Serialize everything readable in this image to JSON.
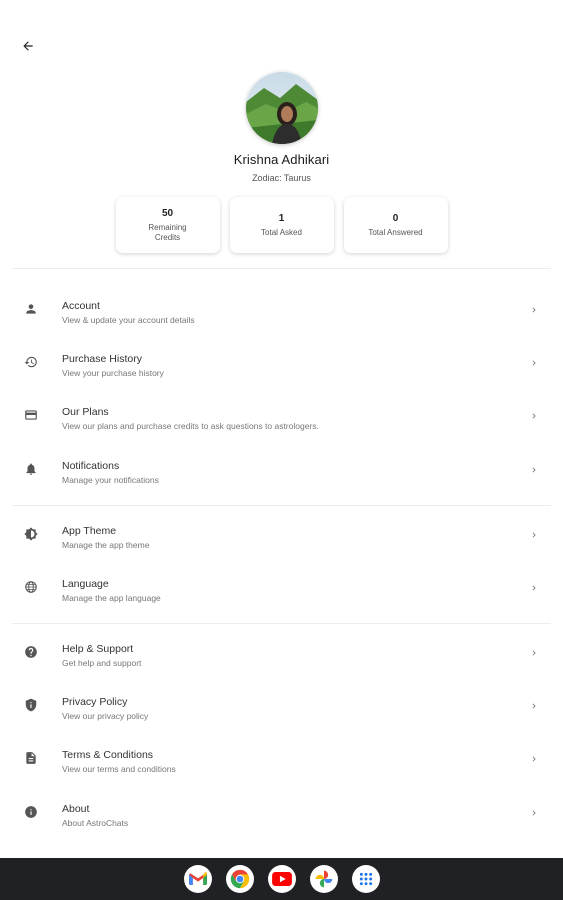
{
  "profile": {
    "name": "Krishna Adhikari",
    "zodiac": "Zodiac: Taurus"
  },
  "stats": [
    {
      "value": "50",
      "label": "Remaining Credits"
    },
    {
      "value": "1",
      "label": "Total Asked"
    },
    {
      "value": "0",
      "label": "Total Answered"
    }
  ],
  "menu": {
    "account": {
      "title": "Account",
      "subtitle": "View & update your account details",
      "icon": "person-icon"
    },
    "purchase_history": {
      "title": "Purchase History",
      "subtitle": "View your purchase history",
      "icon": "history-icon"
    },
    "our_plans": {
      "title": "Our Plans",
      "subtitle": "View our plans and purchase credits to ask questions to astrologers.",
      "icon": "credit-card-icon"
    },
    "notifications": {
      "title": "Notifications",
      "subtitle": "Manage your notifications",
      "icon": "bell-icon"
    },
    "app_theme": {
      "title": "App Theme",
      "subtitle": "Manage the app theme",
      "icon": "theme-icon"
    },
    "language": {
      "title": "Language",
      "subtitle": "Manage the app language",
      "icon": "globe-icon"
    },
    "help_support": {
      "title": "Help & Support",
      "subtitle": "Get help and support",
      "icon": "help-icon"
    },
    "privacy_policy": {
      "title": "Privacy Policy",
      "subtitle": "View our privacy policy",
      "icon": "shield-icon"
    },
    "terms": {
      "title": "Terms & Conditions",
      "subtitle": "View our terms and conditions",
      "icon": "document-icon"
    },
    "about": {
      "title": "About",
      "subtitle": "About AstroChats",
      "icon": "info-icon"
    }
  },
  "taskbar": [
    "gmail-icon",
    "chrome-icon",
    "youtube-icon",
    "photos-icon",
    "app-launcher-icon"
  ],
  "colors": {
    "icon": "#555555",
    "taskbar": "#202124",
    "divider": "#ececec"
  }
}
